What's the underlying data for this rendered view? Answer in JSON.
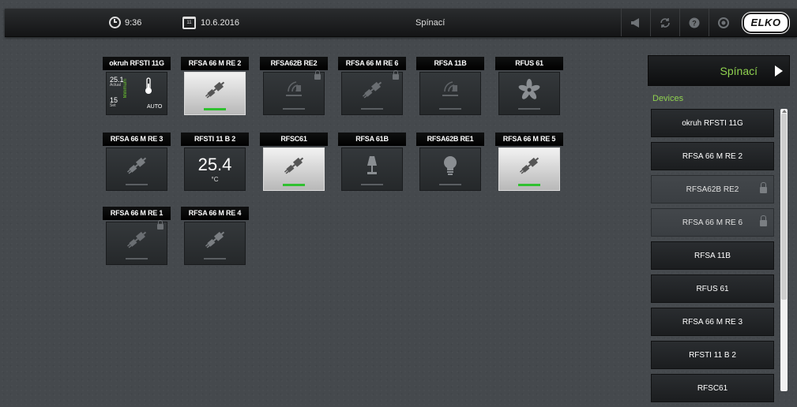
{
  "header": {
    "time": "9:36",
    "date": "10.6.2016",
    "title": "Spínací",
    "logo": "ELKO"
  },
  "tiles": {
    "t1": {
      "name": "okruh RFSTI 11G",
      "actual_value": "25.1",
      "actual_label": "Actual",
      "set_value": "15",
      "set_label": "Set",
      "mode_label": "Minimum",
      "mode": "AUTO"
    },
    "t2": {
      "name": "RFSA 66 M RE 2",
      "state": "on",
      "icon": "plug-icon"
    },
    "t3": {
      "name": "RFSA62B RE2",
      "state": "off",
      "icon": "signal-icon",
      "locked": true
    },
    "t4": {
      "name": "RFSA 66 M RE 6",
      "state": "off",
      "icon": "plug-icon",
      "locked": true
    },
    "t5": {
      "name": "RFSA 11B",
      "state": "off",
      "icon": "signal-icon"
    },
    "t6": {
      "name": "RFUS 61",
      "state": "off",
      "icon": "fan-icon"
    },
    "t7": {
      "name": "RFSA 66 M RE 3",
      "state": "off",
      "icon": "plug-icon"
    },
    "t8": {
      "name": "RFSTI 11 B 2",
      "temperature": "25.4",
      "unit": "°C"
    },
    "t9": {
      "name": "RFSC61",
      "state": "on",
      "icon": "plug-icon"
    },
    "t10": {
      "name": "RFSA 61B",
      "state": "off",
      "icon": "lamp-icon"
    },
    "t11": {
      "name": "RFSA62B RE1",
      "state": "off",
      "icon": "bulb-icon"
    },
    "t12": {
      "name": "RFSA 66 M RE 5",
      "state": "on",
      "icon": "plug-icon"
    },
    "t13": {
      "name": "RFSA 66 M RE 1",
      "state": "off",
      "icon": "plug-icon",
      "locked": true
    },
    "t14": {
      "name": "RFSA 66 M RE 4",
      "state": "off",
      "icon": "plug-icon"
    }
  },
  "sidebar": {
    "title": "Spínací",
    "section": "Devices",
    "items": [
      {
        "label": "okruh RFSTI 11G"
      },
      {
        "label": "RFSA 66 M RE 2"
      },
      {
        "label": "RFSA62B RE2",
        "locked": true
      },
      {
        "label": "RFSA 66 M RE 6",
        "locked": true
      },
      {
        "label": "RFSA 11B"
      },
      {
        "label": "RFUS 61"
      },
      {
        "label": "RFSA 66 M RE 3"
      },
      {
        "label": "RFSTI 11 B 2"
      },
      {
        "label": "RFSC61"
      }
    ]
  },
  "colors": {
    "accent": "#8fd14f",
    "on_indicator": "#30c030"
  }
}
